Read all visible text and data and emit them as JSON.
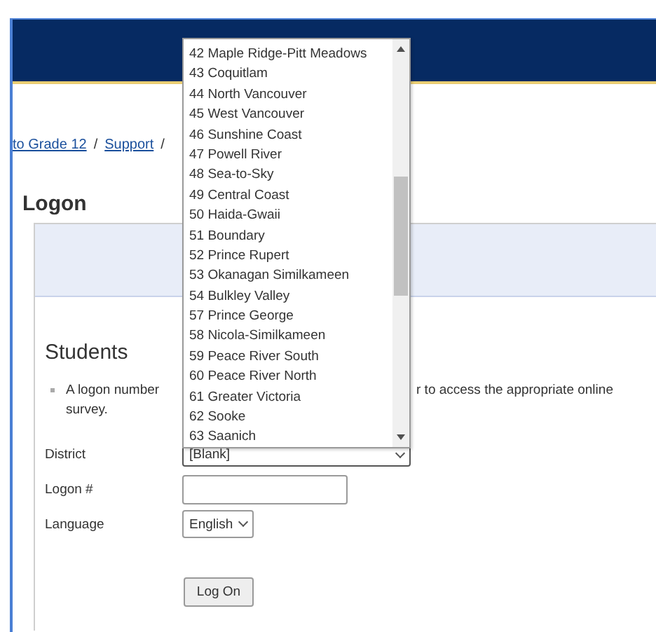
{
  "breadcrumb": [
    {
      "text": "to Grade 12",
      "kind": "link"
    },
    {
      "text": "/",
      "kind": "sep"
    },
    {
      "text": "Support",
      "kind": "link"
    },
    {
      "text": "/",
      "kind": "sep"
    }
  ],
  "heading": "Logon",
  "section_title": "Students",
  "note": {
    "left": "A logon number",
    "right": "r to access the appropriate online",
    "continuation": "survey."
  },
  "form": {
    "district": {
      "label": "District",
      "value": "[Blank]",
      "expanded": true
    },
    "logon": {
      "label": "Logon #"
    },
    "language": {
      "label": "Language",
      "value": "English"
    },
    "submit": "Log On"
  },
  "district_options": [
    "42 Maple Ridge-Pitt Meadows",
    "43 Coquitlam",
    "44 North Vancouver",
    "45 West Vancouver",
    "46 Sunshine Coast",
    "47 Powell River",
    "48 Sea-to-Sky",
    "49 Central Coast",
    "50 Haida-Gwaii",
    "51 Boundary",
    "52 Prince Rupert",
    "53 Okanagan Similkameen",
    "54 Bulkley Valley",
    "57 Prince George",
    "58 Nicola-Similkameen",
    "59 Peace River South",
    "60 Peace River North",
    "61 Greater Victoria",
    "62 Sooke",
    "63 Saanich"
  ]
}
